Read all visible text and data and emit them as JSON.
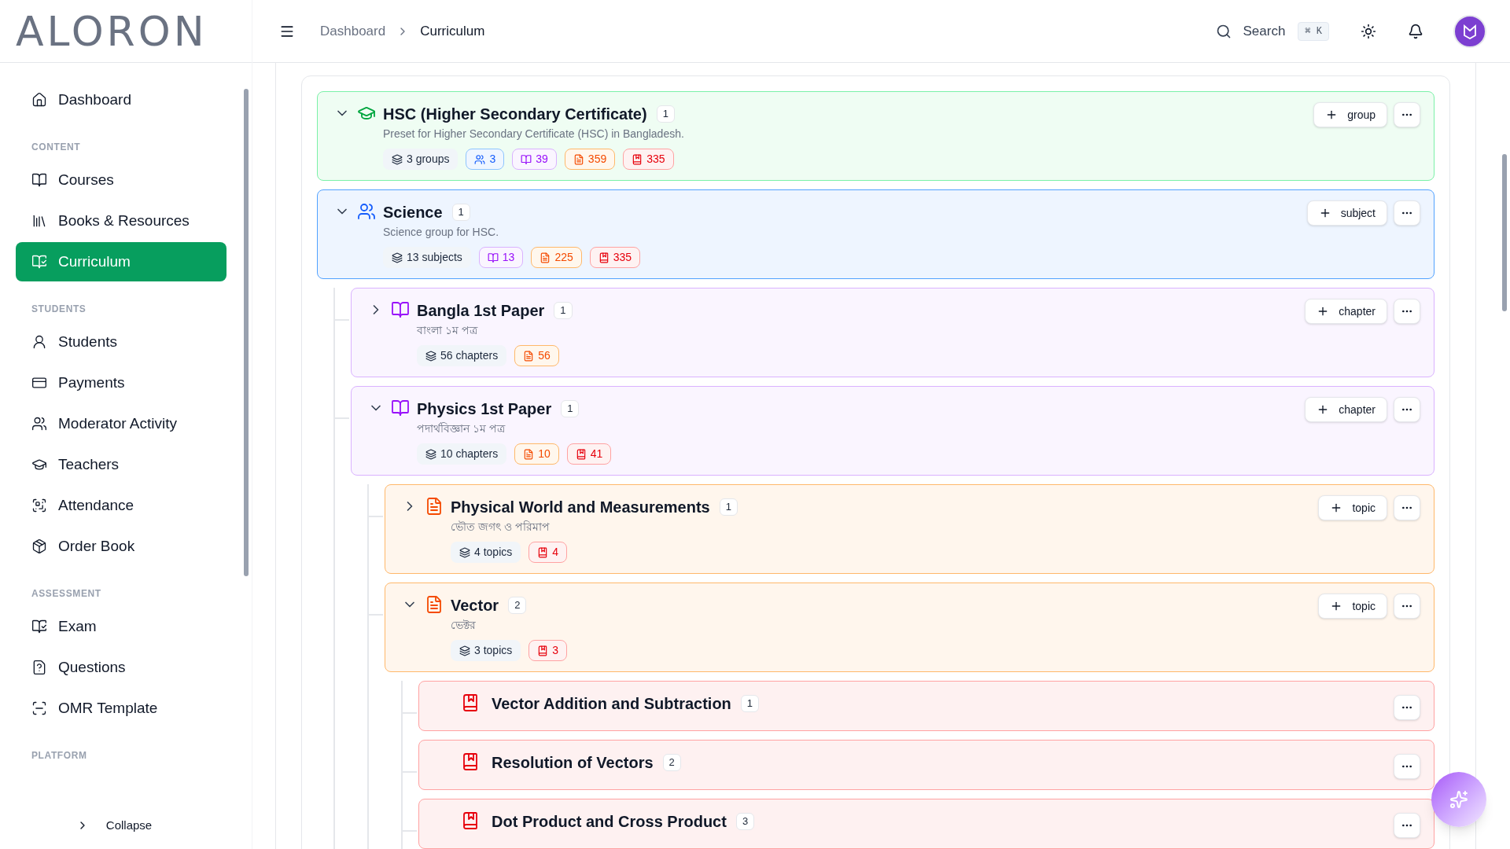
{
  "logo": "ALORON",
  "sidebar": {
    "sections": [
      {
        "items": [
          {
            "label": "Dashboard",
            "selected": false
          }
        ]
      },
      {
        "heading": "CONTENT",
        "items": [
          {
            "label": "Courses",
            "selected": false
          },
          {
            "label": "Books & Resources",
            "selected": false
          },
          {
            "label": "Curriculum",
            "selected": true
          }
        ]
      },
      {
        "heading": "STUDENTS",
        "items": [
          {
            "label": "Students",
            "selected": false
          },
          {
            "label": "Payments",
            "selected": false
          },
          {
            "label": "Moderator Activity",
            "selected": false
          },
          {
            "label": "Teachers",
            "selected": false
          },
          {
            "label": "Attendance",
            "selected": false
          },
          {
            "label": "Order Book",
            "selected": false
          }
        ]
      },
      {
        "heading": "ASSESSMENT",
        "items": [
          {
            "label": "Exam",
            "selected": false
          },
          {
            "label": "Questions",
            "selected": false
          },
          {
            "label": "OMR Template",
            "selected": false
          }
        ]
      },
      {
        "heading": "PLATFORM"
      }
    ],
    "collapse": "Collapse"
  },
  "header": {
    "breadcrumbs": [
      "Dashboard",
      "Curriculum"
    ],
    "search": {
      "label": "Search",
      "shortcut": "⌘ K"
    }
  },
  "tree": [
    {
      "kind": "curriculum",
      "title": "HSC (Higher Secondary Certificate)",
      "count": "1",
      "subtitle": "Preset for Higher Secondary Certificate (HSC) in Bangladesh.",
      "expanded": true,
      "add": "group",
      "stats": [
        {
          "kind": "count",
          "text": "3 groups"
        },
        {
          "kind": "groups",
          "text": "3"
        },
        {
          "kind": "subjects",
          "text": "39"
        },
        {
          "kind": "chapters",
          "text": "359"
        },
        {
          "kind": "topics",
          "text": "335"
        }
      ]
    },
    {
      "kind": "group",
      "title": "Science",
      "count": "1",
      "subtitle": "Science group for HSC.",
      "expanded": true,
      "add": "subject",
      "stats": [
        {
          "kind": "count",
          "text": "13 subjects"
        },
        {
          "kind": "subjects",
          "text": "13"
        },
        {
          "kind": "chapters",
          "text": "225"
        },
        {
          "kind": "topics",
          "text": "335"
        }
      ],
      "children": [
        {
          "kind": "subject",
          "title": "Bangla 1st Paper",
          "count": "1",
          "subtitle": "বাংলা ১ম পত্র",
          "expanded": false,
          "add": "chapter",
          "stats": [
            {
              "kind": "count",
              "text": "56 chapters"
            },
            {
              "kind": "chapters",
              "text": "56"
            }
          ]
        },
        {
          "kind": "subject",
          "title": "Physics 1st Paper",
          "count": "1",
          "subtitle": "পদার্থবিজ্ঞান ১ম পত্র",
          "expanded": true,
          "add": "chapter",
          "stats": [
            {
              "kind": "count",
              "text": "10 chapters"
            },
            {
              "kind": "chapters",
              "text": "10"
            },
            {
              "kind": "topics",
              "text": "41"
            }
          ],
          "children": [
            {
              "kind": "chapter",
              "title": "Physical World and Measurements",
              "count": "1",
              "subtitle": "ভৌত জগৎ ও পরিমাপ",
              "expanded": false,
              "add": "topic",
              "stats": [
                {
                  "kind": "count",
                  "text": "4 topics"
                },
                {
                  "kind": "topics",
                  "text": "4"
                }
              ]
            },
            {
              "kind": "chapter",
              "title": "Vector",
              "count": "2",
              "subtitle": "ভেক্টর",
              "expanded": true,
              "add": "topic",
              "stats": [
                {
                  "kind": "count",
                  "text": "3 topics"
                },
                {
                  "kind": "topics",
                  "text": "3"
                }
              ],
              "children": [
                {
                  "kind": "topic",
                  "title": "Vector Addition and Subtraction",
                  "count": "1"
                },
                {
                  "kind": "topic",
                  "title": "Resolution of Vectors",
                  "count": "2"
                },
                {
                  "kind": "topic",
                  "title": "Dot Product and Cross Product",
                  "count": "3"
                }
              ]
            }
          ]
        }
      ]
    }
  ]
}
